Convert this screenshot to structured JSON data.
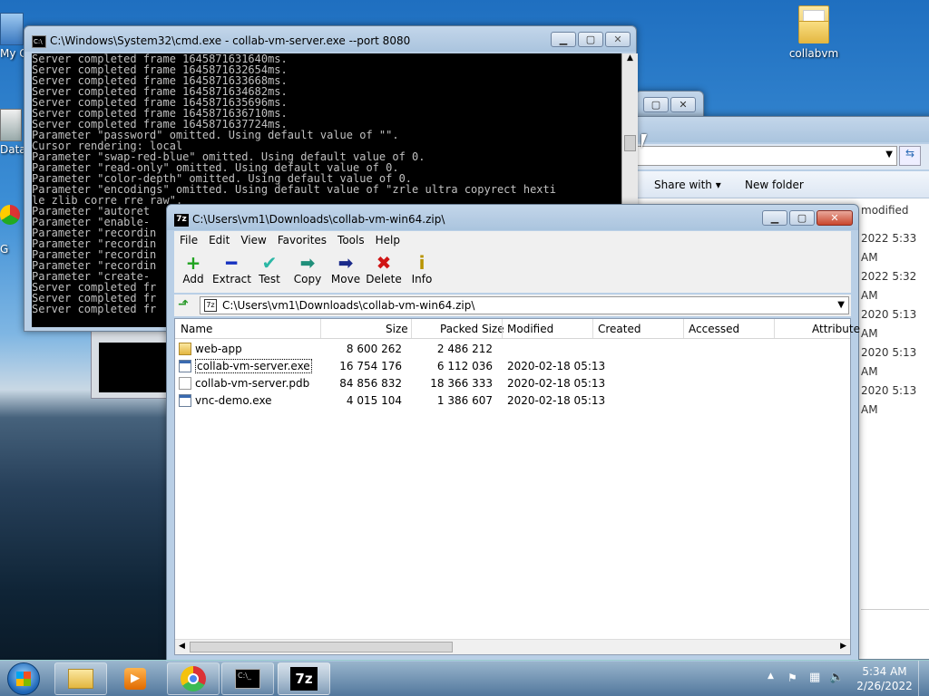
{
  "desktop": {
    "icons": [
      {
        "label": "collabvm"
      },
      {
        "label": "My C"
      },
      {
        "label": "Data"
      },
      {
        "label": "G"
      },
      {
        "label": "C"
      }
    ]
  },
  "cmd": {
    "title": "C:\\Windows\\System32\\cmd.exe - collab-vm-server.exe  --port 8080",
    "lines": [
      "Server completed frame 1645871631640ms.",
      "Server completed frame 1645871632654ms.",
      "Server completed frame 1645871633668ms.",
      "Server completed frame 1645871634682ms.",
      "Server completed frame 1645871635696ms.",
      "Server completed frame 1645871636710ms.",
      "Server completed frame 1645871637724ms.",
      "Parameter \"password\" omitted. Using default value of \"\".",
      "Cursor rendering: local",
      "Parameter \"swap-red-blue\" omitted. Using default value of 0.",
      "Parameter \"read-only\" omitted. Using default value of 0.",
      "Parameter \"color-depth\" omitted. Using default value of 0.",
      "Parameter \"encodings\" omitted. Using default value of \"zrle ultra copyrect hexti",
      "le zlib corre rre raw\".",
      "Parameter \"autoret",
      "Parameter \"enable-",
      "Parameter \"recordin",
      "Parameter \"recordin",
      "Parameter \"recordin",
      "Parameter \"recordin",
      "Parameter \"create-",
      "Server completed fr",
      "Server completed fr",
      "Server completed fr"
    ]
  },
  "explorer": {
    "share_with": "Share with",
    "new_folder": "New folder",
    "modified_header": "modified",
    "dates": [
      "2022 5:33 AM",
      "2022 5:32 AM",
      "2020 5:13 AM",
      "2020 5:13 AM",
      "2020 5:13 AM"
    ]
  },
  "sevenzip": {
    "title": "C:\\Users\\vm1\\Downloads\\collab-vm-win64.zip\\",
    "menu": [
      "File",
      "Edit",
      "View",
      "Favorites",
      "Tools",
      "Help"
    ],
    "tools": [
      {
        "label": "Add",
        "icon": "add-icon",
        "glyph": "+",
        "color": "#1fa31f"
      },
      {
        "label": "Extract",
        "icon": "extract-icon",
        "glyph": "━",
        "color": "#1530c0"
      },
      {
        "label": "Test",
        "icon": "test-icon",
        "glyph": "✔",
        "color": "#2bb7a5"
      },
      {
        "label": "Copy",
        "icon": "copy-icon",
        "glyph": "➡",
        "color": "#1f8f7a"
      },
      {
        "label": "Move",
        "icon": "move-icon",
        "glyph": "➡",
        "color": "#1a2a8a"
      },
      {
        "label": "Delete",
        "icon": "delete-icon",
        "glyph": "✖",
        "color": "#d01515"
      },
      {
        "label": "Info",
        "icon": "info-icon",
        "glyph": "i",
        "color": "#b89400"
      }
    ],
    "address": "C:\\Users\\vm1\\Downloads\\collab-vm-win64.zip\\",
    "columns": [
      "Name",
      "Size",
      "Packed Size",
      "Modified",
      "Created",
      "Accessed",
      "Attribute"
    ],
    "files": [
      {
        "name": "web-app",
        "size": "8 600 262",
        "packed": "2 486 212",
        "modified": "",
        "kind": "folder"
      },
      {
        "name": "collab-vm-server.exe",
        "size": "16 754 176",
        "packed": "6 112 036",
        "modified": "2020-02-18 05:13",
        "kind": "exe"
      },
      {
        "name": "collab-vm-server.pdb",
        "size": "84 856 832",
        "packed": "18 366 333",
        "modified": "2020-02-18 05:13",
        "kind": "file"
      },
      {
        "name": "vnc-demo.exe",
        "size": "4 015 104",
        "packed": "1 386 607",
        "modified": "2020-02-18 05:13",
        "kind": "exe"
      }
    ]
  },
  "taskbar": {
    "time": "5:34 AM",
    "date": "2/26/2022"
  }
}
